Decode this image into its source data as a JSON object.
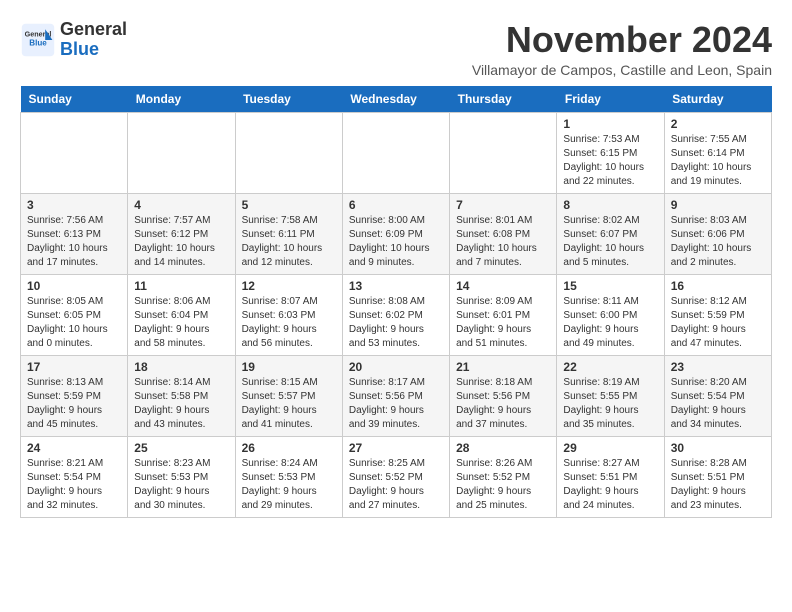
{
  "header": {
    "logo_general": "General",
    "logo_blue": "Blue",
    "month_title": "November 2024",
    "location": "Villamayor de Campos, Castille and Leon, Spain"
  },
  "weekdays": [
    "Sunday",
    "Monday",
    "Tuesday",
    "Wednesday",
    "Thursday",
    "Friday",
    "Saturday"
  ],
  "weeks": [
    [
      {
        "day": "",
        "info": ""
      },
      {
        "day": "",
        "info": ""
      },
      {
        "day": "",
        "info": ""
      },
      {
        "day": "",
        "info": ""
      },
      {
        "day": "",
        "info": ""
      },
      {
        "day": "1",
        "info": "Sunrise: 7:53 AM\nSunset: 6:15 PM\nDaylight: 10 hours\nand 22 minutes."
      },
      {
        "day": "2",
        "info": "Sunrise: 7:55 AM\nSunset: 6:14 PM\nDaylight: 10 hours\nand 19 minutes."
      }
    ],
    [
      {
        "day": "3",
        "info": "Sunrise: 7:56 AM\nSunset: 6:13 PM\nDaylight: 10 hours\nand 17 minutes."
      },
      {
        "day": "4",
        "info": "Sunrise: 7:57 AM\nSunset: 6:12 PM\nDaylight: 10 hours\nand 14 minutes."
      },
      {
        "day": "5",
        "info": "Sunrise: 7:58 AM\nSunset: 6:11 PM\nDaylight: 10 hours\nand 12 minutes."
      },
      {
        "day": "6",
        "info": "Sunrise: 8:00 AM\nSunset: 6:09 PM\nDaylight: 10 hours\nand 9 minutes."
      },
      {
        "day": "7",
        "info": "Sunrise: 8:01 AM\nSunset: 6:08 PM\nDaylight: 10 hours\nand 7 minutes."
      },
      {
        "day": "8",
        "info": "Sunrise: 8:02 AM\nSunset: 6:07 PM\nDaylight: 10 hours\nand 5 minutes."
      },
      {
        "day": "9",
        "info": "Sunrise: 8:03 AM\nSunset: 6:06 PM\nDaylight: 10 hours\nand 2 minutes."
      }
    ],
    [
      {
        "day": "10",
        "info": "Sunrise: 8:05 AM\nSunset: 6:05 PM\nDaylight: 10 hours\nand 0 minutes."
      },
      {
        "day": "11",
        "info": "Sunrise: 8:06 AM\nSunset: 6:04 PM\nDaylight: 9 hours\nand 58 minutes."
      },
      {
        "day": "12",
        "info": "Sunrise: 8:07 AM\nSunset: 6:03 PM\nDaylight: 9 hours\nand 56 minutes."
      },
      {
        "day": "13",
        "info": "Sunrise: 8:08 AM\nSunset: 6:02 PM\nDaylight: 9 hours\nand 53 minutes."
      },
      {
        "day": "14",
        "info": "Sunrise: 8:09 AM\nSunset: 6:01 PM\nDaylight: 9 hours\nand 51 minutes."
      },
      {
        "day": "15",
        "info": "Sunrise: 8:11 AM\nSunset: 6:00 PM\nDaylight: 9 hours\nand 49 minutes."
      },
      {
        "day": "16",
        "info": "Sunrise: 8:12 AM\nSunset: 5:59 PM\nDaylight: 9 hours\nand 47 minutes."
      }
    ],
    [
      {
        "day": "17",
        "info": "Sunrise: 8:13 AM\nSunset: 5:59 PM\nDaylight: 9 hours\nand 45 minutes."
      },
      {
        "day": "18",
        "info": "Sunrise: 8:14 AM\nSunset: 5:58 PM\nDaylight: 9 hours\nand 43 minutes."
      },
      {
        "day": "19",
        "info": "Sunrise: 8:15 AM\nSunset: 5:57 PM\nDaylight: 9 hours\nand 41 minutes."
      },
      {
        "day": "20",
        "info": "Sunrise: 8:17 AM\nSunset: 5:56 PM\nDaylight: 9 hours\nand 39 minutes."
      },
      {
        "day": "21",
        "info": "Sunrise: 8:18 AM\nSunset: 5:56 PM\nDaylight: 9 hours\nand 37 minutes."
      },
      {
        "day": "22",
        "info": "Sunrise: 8:19 AM\nSunset: 5:55 PM\nDaylight: 9 hours\nand 35 minutes."
      },
      {
        "day": "23",
        "info": "Sunrise: 8:20 AM\nSunset: 5:54 PM\nDaylight: 9 hours\nand 34 minutes."
      }
    ],
    [
      {
        "day": "24",
        "info": "Sunrise: 8:21 AM\nSunset: 5:54 PM\nDaylight: 9 hours\nand 32 minutes."
      },
      {
        "day": "25",
        "info": "Sunrise: 8:23 AM\nSunset: 5:53 PM\nDaylight: 9 hours\nand 30 minutes."
      },
      {
        "day": "26",
        "info": "Sunrise: 8:24 AM\nSunset: 5:53 PM\nDaylight: 9 hours\nand 29 minutes."
      },
      {
        "day": "27",
        "info": "Sunrise: 8:25 AM\nSunset: 5:52 PM\nDaylight: 9 hours\nand 27 minutes."
      },
      {
        "day": "28",
        "info": "Sunrise: 8:26 AM\nSunset: 5:52 PM\nDaylight: 9 hours\nand 25 minutes."
      },
      {
        "day": "29",
        "info": "Sunrise: 8:27 AM\nSunset: 5:51 PM\nDaylight: 9 hours\nand 24 minutes."
      },
      {
        "day": "30",
        "info": "Sunrise: 8:28 AM\nSunset: 5:51 PM\nDaylight: 9 hours\nand 23 minutes."
      }
    ]
  ]
}
